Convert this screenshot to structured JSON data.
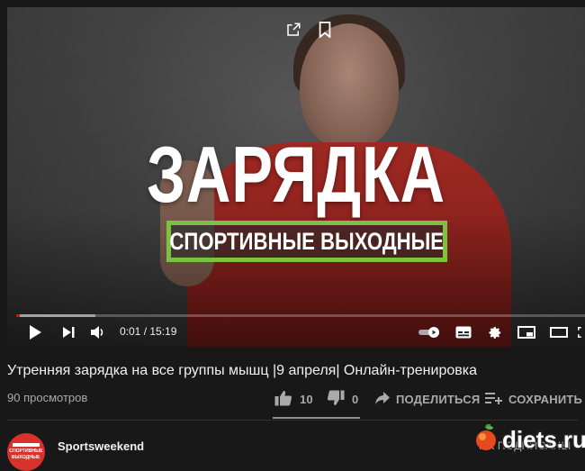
{
  "player": {
    "overlay_title": "ЗАРЯДКА",
    "overlay_subtitle": "СПОРТИВНЫЕ ВЫХОДНЫЕ",
    "time": "0:01 / 15:19",
    "progress_played": 0.0011,
    "progress_loaded": 0.14,
    "accent_color": "#ff0000",
    "subtitle_border_color": "#7cc242"
  },
  "video": {
    "title": "Утренняя зарядка на все группы мышц |9 апреля| Онлайн-тренировка",
    "views": "90 просмотров",
    "likes": "10",
    "dislikes": "0",
    "share_label": "ПОДЕЛИТЬСЯ",
    "save_label": "СОХРАНИТЬ"
  },
  "channel": {
    "name": "Sportsweekend",
    "avatar_text_top": "СПОРТИВНЫЕ",
    "avatar_text_bottom": "ВЫХОДНЫЕ",
    "subscribe_label": "НА ПОДПИСАНЫ"
  },
  "watermark": {
    "text": "diets.ru"
  }
}
